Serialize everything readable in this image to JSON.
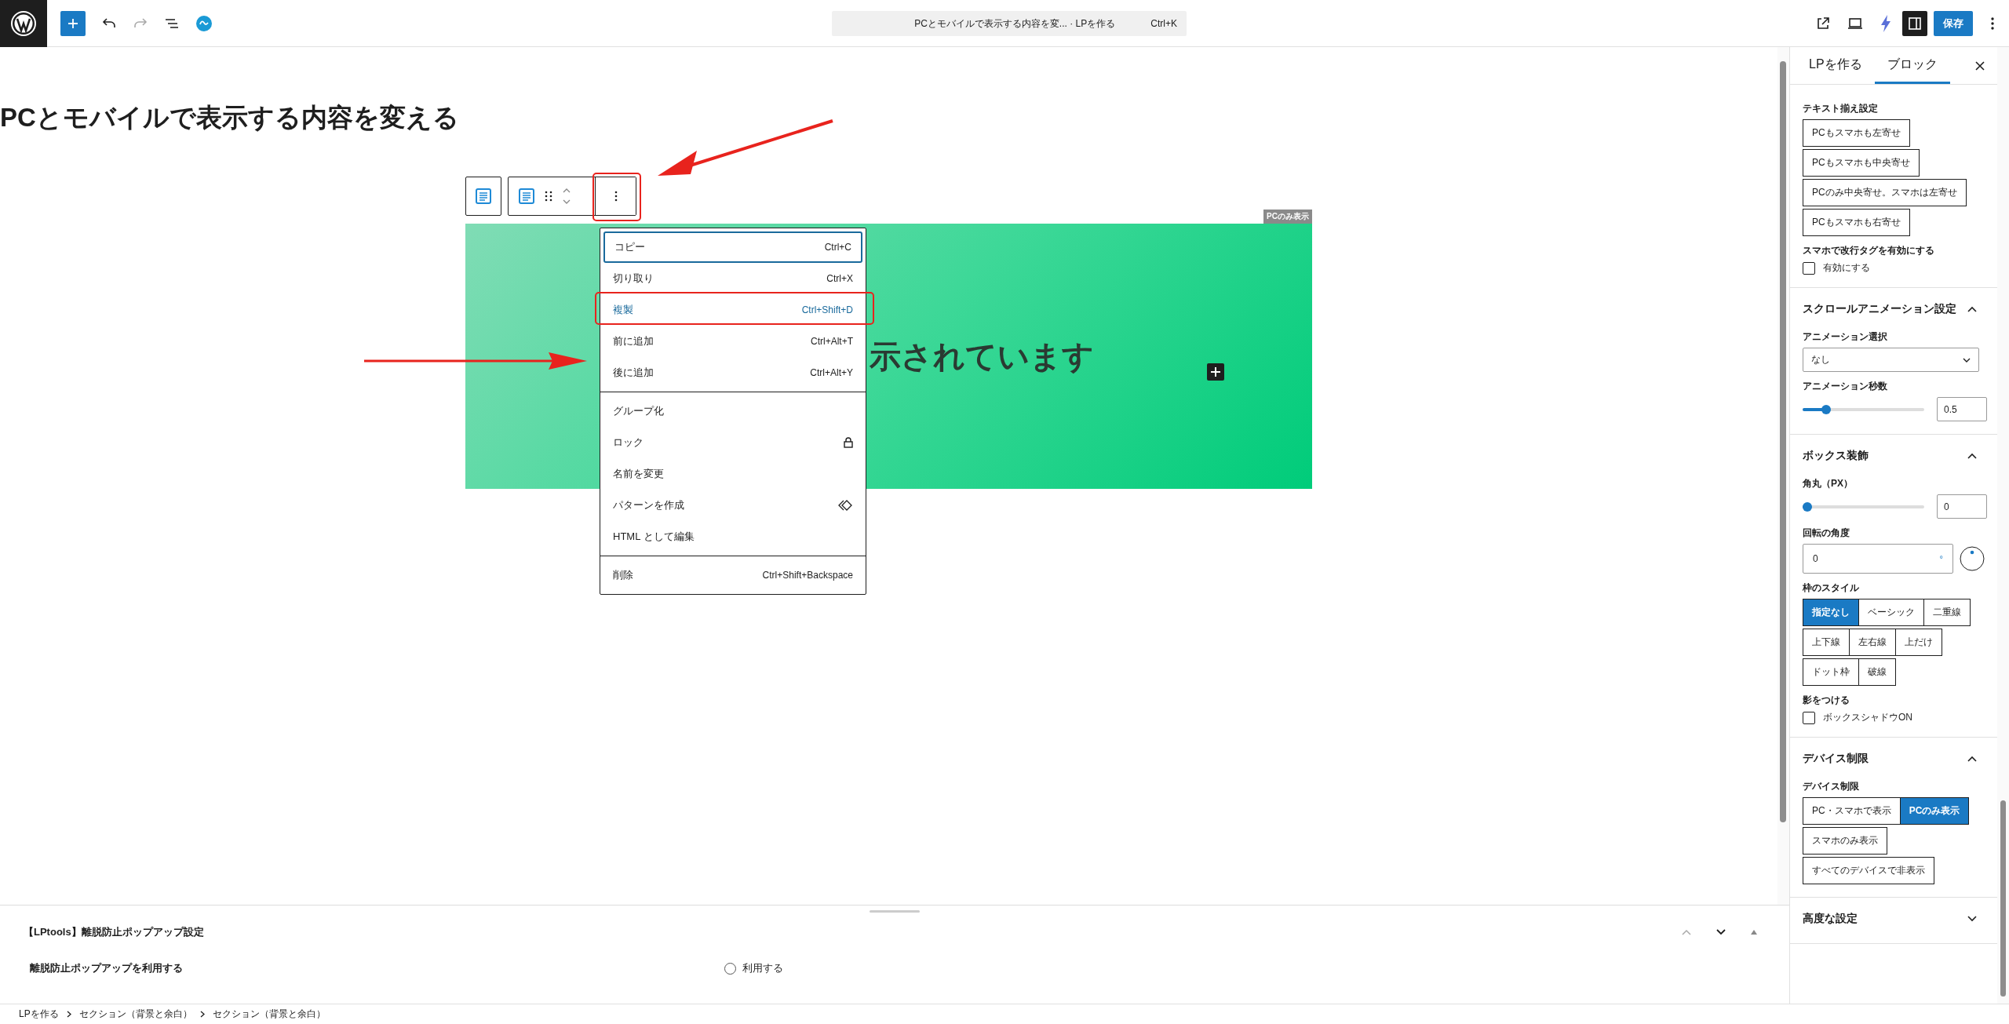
{
  "command_bar": {
    "title": "PCとモバイルで表示する内容を変... · LPを作る",
    "shortcut": "Ctrl+K"
  },
  "save_button": "保存",
  "page_title": "PCとモバイルで表示する内容を変える",
  "block": {
    "badge": "PCのみ表示",
    "heading": "示されています"
  },
  "menu": {
    "groups": [
      [
        {
          "label": "コピー",
          "kind": "shortcut",
          "shortcut": "Ctrl+C",
          "focused": true,
          "selected": false
        },
        {
          "label": "切り取り",
          "kind": "shortcut",
          "shortcut": "Ctrl+X",
          "focused": false,
          "selected": false
        },
        {
          "label": "複製",
          "kind": "shortcut",
          "shortcut": "Ctrl+Shift+D",
          "focused": false,
          "selected": true
        },
        {
          "label": "前に追加",
          "kind": "shortcut",
          "shortcut": "Ctrl+Alt+T",
          "focused": false,
          "selected": false
        },
        {
          "label": "後に追加",
          "kind": "shortcut",
          "shortcut": "Ctrl+Alt+Y",
          "focused": false,
          "selected": false
        }
      ],
      [
        {
          "label": "グループ化",
          "kind": "plain",
          "focused": false,
          "selected": false
        },
        {
          "label": "ロック",
          "kind": "lock",
          "focused": false,
          "selected": false
        },
        {
          "label": "名前を変更",
          "kind": "plain",
          "focused": false,
          "selected": false
        },
        {
          "label": "パターンを作成",
          "kind": "pattern",
          "focused": false,
          "selected": false
        },
        {
          "label": "HTML として編集",
          "kind": "plain",
          "focused": false,
          "selected": false
        }
      ],
      [
        {
          "label": "削除",
          "kind": "shortcut",
          "shortcut": "Ctrl+Shift+Backspace",
          "focused": false,
          "selected": false
        }
      ]
    ]
  },
  "sidebar": {
    "tabs": [
      {
        "label": "LPを作る",
        "selected": false
      },
      {
        "label": "ブロック",
        "selected": true
      }
    ],
    "top_controls": [
      {
        "kind": "buttons",
        "label": "テキスト揃え設定",
        "options": [
          {
            "label": "PCもスマホも左寄せ",
            "selected": false
          },
          {
            "label": "PCもスマホも中央寄せ",
            "selected": false
          },
          {
            "label": "PCのみ中央寄せ。スマホは左寄せ",
            "selected": false
          },
          {
            "label": "PCもスマホも右寄せ",
            "selected": false
          }
        ]
      },
      {
        "kind": "checkbox",
        "label": "スマホで改行タグを有効にする",
        "option": "有効にする",
        "checked": false
      }
    ],
    "sections": [
      {
        "title": "スクロールアニメーション設定",
        "expanded": true,
        "controls": [
          {
            "kind": "select",
            "label": "アニメーション選択",
            "value": "なし"
          },
          {
            "kind": "slider",
            "label": "アニメーション秒数",
            "level": 0.17,
            "value": "0.5"
          }
        ]
      },
      {
        "title": "ボックス装飾",
        "expanded": true,
        "controls": [
          {
            "kind": "slider",
            "label": "角丸（PX）",
            "level": 0,
            "value": "0"
          },
          {
            "kind": "angle",
            "label": "回転の角度",
            "value": "0",
            "unit": "°"
          },
          {
            "kind": "buttons",
            "label": "枠のスタイル",
            "options": [
              {
                "label": "指定なし",
                "selected": true
              },
              {
                "label": "ベーシック",
                "selected": false
              },
              {
                "label": "二重線",
                "selected": false
              },
              {
                "label": "上下線",
                "selected": false
              },
              {
                "label": "左右線",
                "selected": false
              },
              {
                "label": "上だけ",
                "selected": false
              },
              {
                "label": "ドット枠",
                "selected": false
              },
              {
                "label": "破線",
                "selected": false
              }
            ]
          },
          {
            "kind": "checkbox",
            "label": "影をつける",
            "option": "ボックスシャドウON",
            "checked": false
          }
        ]
      },
      {
        "title": "デバイス制限",
        "expanded": true,
        "controls": [
          {
            "kind": "buttons",
            "label": "デバイス制限",
            "options": [
              {
                "label": "PC・スマホで表示",
                "selected": false
              },
              {
                "label": "PCのみ表示",
                "selected": true
              },
              {
                "label": "スマホのみ表示",
                "selected": false
              },
              {
                "label": "すべてのデバイスで非表示",
                "selected": false
              }
            ]
          }
        ]
      },
      {
        "title": "高度な設定",
        "expanded": false
      }
    ]
  },
  "bottom_panel": {
    "title": "【LPtools】離脱防止ポップアップ設定",
    "row_label": "離脱防止ポップアップを利用する",
    "radio": {
      "label": "利用する",
      "selected": false
    }
  },
  "breadcrumb": [
    "LPを作る",
    "セクション（背景と余白）",
    "セクション（背景と余白）"
  ]
}
